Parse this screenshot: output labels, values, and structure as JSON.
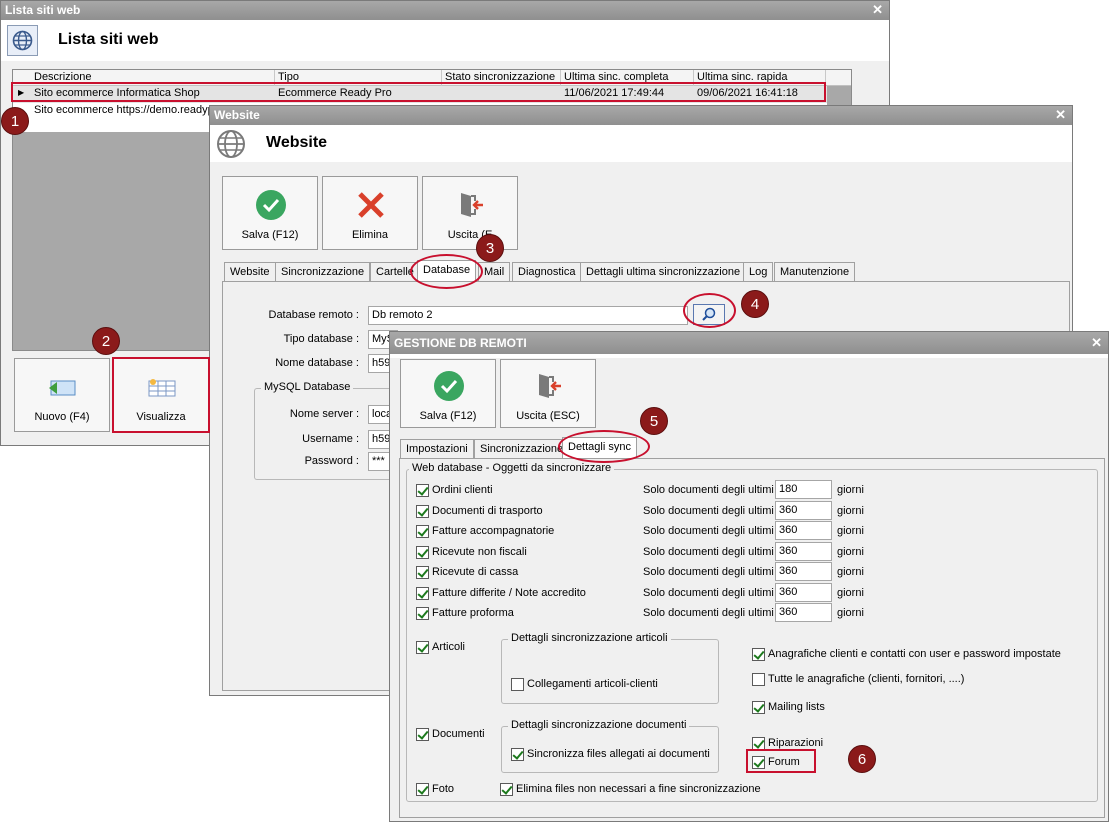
{
  "lista": {
    "window_title": "Lista siti web",
    "header_title": "Lista siti web",
    "columns": [
      "Descrizione",
      "Tipo",
      "Stato sincronizzazione",
      "Ultima sinc. completa",
      "Ultima sinc. rapida"
    ],
    "rows": [
      {
        "descrizione": "Sito ecommerce Informatica Shop",
        "tipo": "Ecommerce Ready Pro",
        "stato": "",
        "completa": "11/06/2021 17:49:44",
        "rapida": "09/06/2021 16:41:18"
      },
      {
        "descrizione": "Sito ecommerce https://demo.readyp",
        "tipo": "",
        "stato": "",
        "completa": "",
        "rapida": ""
      }
    ],
    "row_marker": "▶",
    "nuovo_label": "Nuovo (F4)",
    "visualizza_label": "Visualizza",
    "close": "✕"
  },
  "website": {
    "window_title": "Website",
    "header_title": "Website",
    "salva_label": "Salva (F12)",
    "elimina_label": "Elimina",
    "uscita_label": "Uscita (E",
    "tabs": [
      "Website",
      "Sincronizzazione",
      "Cartelle",
      "Database",
      "Mail",
      "Diagnostica",
      "Dettagli ultima sincronizzazione",
      "Log",
      "Manutenzione"
    ],
    "db_remoto_label": "Database remoto :",
    "db_remoto_value": "Db remoto 2",
    "tipo_db_label": "Tipo database :",
    "tipo_db_value": "MyS",
    "nome_db_label": "Nome database :",
    "nome_db_value": "h59",
    "mysql_group": "MySQL Database",
    "server_label": "Nome server :",
    "server_value": "loca",
    "user_label": "Username :",
    "user_value": "h59",
    "pass_label": "Password :",
    "pass_value": "***",
    "close": "✕"
  },
  "gestione": {
    "window_title": "GESTIONE DB REMOTI",
    "salva_label": "Salva (F12)",
    "uscita_label": "Uscita (ESC)",
    "tabs": [
      "Impostazioni",
      "Sincronizzazione",
      "Dettagli sync"
    ],
    "group_title": "Web database - Oggetti da sincronizzare",
    "solo_label": "Solo documenti degli ultimi",
    "giorni_label": "giorni",
    "docs": [
      {
        "label": "Ordini clienti",
        "days": "180",
        "checked": true
      },
      {
        "label": "Documenti di trasporto",
        "days": "360",
        "checked": true
      },
      {
        "label": "Fatture accompagnatorie",
        "days": "360",
        "checked": true
      },
      {
        "label": "Ricevute non fiscali",
        "days": "360",
        "checked": true
      },
      {
        "label": "Ricevute di cassa",
        "days": "360",
        "checked": true
      },
      {
        "label": "Fatture differite / Note accredito",
        "days": "360",
        "checked": true
      },
      {
        "label": "Fatture proforma",
        "days": "360",
        "checked": true
      }
    ],
    "articoli_label": "Articoli",
    "articoli_group": "Dettagli sincronizzazione articoli",
    "collegamenti_label": "Collegamenti articoli-clienti",
    "anagrafiche_label": "Anagrafiche clienti e contatti con user e password impostate",
    "tutte_label": "Tutte le anagrafiche (clienti, fornitori, ....)",
    "mailing_label": "Mailing lists",
    "documenti_label": "Documenti",
    "documenti_group": "Dettagli sincronizzazione documenti",
    "allegati_label": "Sincronizza files allegati ai documenti",
    "riparazioni_label": "Riparazioni",
    "forum_label": "Forum",
    "foto_label": "Foto",
    "elimina_files_label": "Elimina files non necessari a fine sincronizzazione",
    "close": "✕"
  },
  "badges": [
    "1",
    "2",
    "3",
    "4",
    "5",
    "6"
  ]
}
